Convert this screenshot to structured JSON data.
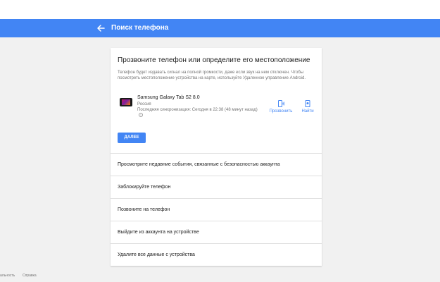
{
  "header": {
    "title": "Поиск телефона",
    "back_icon": "arrow-back-icon",
    "color": "#4285f4"
  },
  "card": {
    "title": "Прозвоните телефон или определите его местоположение",
    "description": "Телефон будет издавать сигнал на полной громкости, даже если звук на нем отключен. Чтобы посмотреть местоположение устройства на карте, используйте Удаленное управление Android.",
    "device": {
      "name": "Samsung Galaxy Tab S2 8.0",
      "country": "Россия",
      "last_sync": "Последняя синхронизация: Сегодня в 22:38 (48 минут назад)"
    },
    "actions": {
      "ring": "Прозвонить",
      "find": "Найти"
    },
    "next_button": "ДАЛЕЕ"
  },
  "list_items": [
    "Просмотрите недавние события, связанные с безопасностью аккаунта",
    "Заблокируйте телефон",
    "Позвоните на телефон",
    "Выйдите из аккаунта на устройстве",
    "Удалите все данные с устройства"
  ],
  "footer": {
    "left": "альность",
    "right": "Справка"
  }
}
